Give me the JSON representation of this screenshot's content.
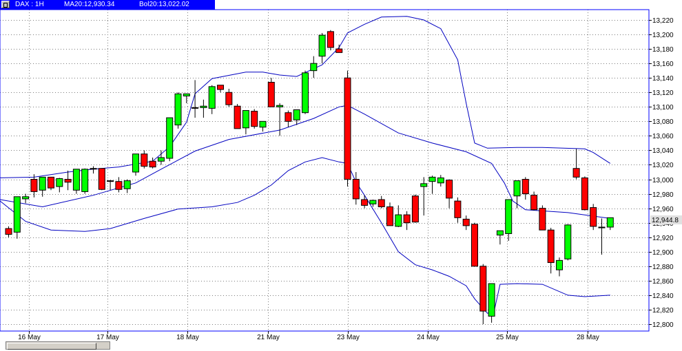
{
  "header": {
    "symbol": "DAX : 1H",
    "ma": "MA20:12,930.34",
    "bol": "Bol20:13,022.02"
  },
  "last_price_label": "12,944.8",
  "colors": {
    "up": "#00ff00",
    "down": "#ff0000",
    "band": "#0000c0",
    "grid": "#888888",
    "accent": "#0000ff"
  },
  "icons": {
    "system": "window-menu-icon"
  },
  "chart_data": {
    "type": "candlestick",
    "title": "",
    "ylim": [
      12790,
      13240
    ],
    "y_ticks": [
      12800,
      12820,
      12840,
      12860,
      12880,
      12900,
      12920,
      12940,
      12960,
      12980,
      13000,
      13020,
      13040,
      13060,
      13080,
      13100,
      13120,
      13140,
      13160,
      13180,
      13200,
      13220
    ],
    "y_tick_labels": [
      "12,800",
      "12,820",
      "12,840",
      "12,860",
      "12,880",
      "12,900",
      "12,920",
      "12,940",
      "12,960",
      "12,980",
      "13,000",
      "13,020",
      "13,040",
      "13,060",
      "13,080",
      "13,100",
      "13,120",
      "13,140",
      "13,160",
      "13,180",
      "13,200",
      "13,220"
    ],
    "x_labels": [
      {
        "label": "16 May",
        "index": 2.4
      },
      {
        "label": "17 May",
        "index": 11.7
      },
      {
        "label": "18 May",
        "index": 21.1
      },
      {
        "label": "21 May",
        "index": 30.6
      },
      {
        "label": "23 May",
        "index": 40.0
      },
      {
        "label": "24 May",
        "index": 49.5
      },
      {
        "label": "25 May",
        "index": 58.8
      },
      {
        "label": "28 May",
        "index": 68.3
      }
    ],
    "candles": [
      [
        12932,
        12935,
        12920,
        12924
      ],
      [
        12927,
        12976,
        12918,
        12976
      ],
      [
        12973,
        12980,
        12967,
        12976
      ],
      [
        13000,
        13007,
        12975,
        12983
      ],
      [
        12985,
        13003,
        12976,
        13003
      ],
      [
        13003,
        13003,
        12985,
        12988
      ],
      [
        12990,
        13002,
        12982,
        13001
      ],
      [
        13000,
        13012,
        12985,
        12996
      ],
      [
        12985,
        13014,
        12980,
        13014
      ],
      [
        12983,
        13015,
        12980,
        13014
      ],
      [
        13015,
        13018,
        13008,
        13015
      ],
      [
        13015,
        13015,
        12985,
        12986
      ],
      [
        12998,
        12999,
        12985,
        12997
      ],
      [
        12997,
        13003,
        12982,
        12986
      ],
      [
        12987,
        13000,
        12981,
        12998
      ],
      [
        13010,
        13035,
        13005,
        13035
      ],
      [
        13035,
        13040,
        13015,
        13018
      ],
      [
        13025,
        13030,
        13015,
        13017
      ],
      [
        13025,
        13040,
        13020,
        13030
      ],
      [
        13029,
        13085,
        13025,
        13085
      ],
      [
        13075,
        13120,
        13070,
        13118
      ],
      [
        13115,
        13118,
        13105,
        13118
      ],
      [
        13099,
        13137,
        13085,
        13098
      ],
      [
        13099,
        13110,
        13085,
        13101
      ],
      [
        13098,
        13130,
        13090,
        13128
      ],
      [
        13130,
        13130,
        13120,
        13124
      ],
      [
        13120,
        13125,
        13100,
        13103
      ],
      [
        13101,
        13104,
        13070,
        13070
      ],
      [
        13071,
        13090,
        13062,
        13095
      ],
      [
        13094,
        13097,
        13070,
        13073
      ],
      [
        13072,
        13076,
        13066,
        13080
      ],
      [
        13134,
        13140,
        13100,
        13100
      ],
      [
        13100,
        13105,
        13060,
        13102
      ],
      [
        13092,
        13095,
        13072,
        13080
      ],
      [
        13082,
        13095,
        13075,
        13096
      ],
      [
        13092,
        13150,
        13090,
        13147
      ],
      [
        13150,
        13170,
        13140,
        13160
      ],
      [
        13170,
        13202,
        13160,
        13199
      ],
      [
        13204,
        13206,
        13178,
        13182
      ],
      [
        13180,
        13186,
        13176,
        13175
      ],
      [
        13140,
        13150,
        12990,
        13000
      ],
      [
        13000,
        13010,
        12965,
        12973
      ],
      [
        12972,
        12978,
        12960,
        12964
      ],
      [
        12966,
        12972,
        12962,
        12971
      ],
      [
        12972,
        12977,
        12960,
        12962
      ],
      [
        12962,
        12968,
        12940,
        12936
      ],
      [
        12935,
        12964,
        12934,
        12951
      ],
      [
        12951,
        12956,
        12930,
        12940
      ],
      [
        12977,
        12979,
        12940,
        12941
      ],
      [
        12990,
        13003,
        12950,
        12994
      ],
      [
        12997,
        13005,
        12980,
        13003
      ],
      [
        12995,
        13006,
        12990,
        13002
      ],
      [
        12999,
        13000,
        12960,
        12974
      ],
      [
        12970,
        12975,
        12940,
        12947
      ],
      [
        12945,
        12950,
        12930,
        12936
      ],
      [
        12938,
        12940,
        12880,
        12880
      ],
      [
        12880,
        12883,
        12800,
        12818
      ],
      [
        12811,
        12840,
        12802,
        12856
      ],
      [
        12923,
        12926,
        12910,
        12929
      ],
      [
        12925,
        12935,
        12915,
        12972
      ],
      [
        12977,
        12996,
        12960,
        12998
      ],
      [
        13000,
        13003,
        12972,
        12980
      ],
      [
        12978,
        12983,
        12957,
        12958
      ],
      [
        12960,
        12964,
        12937,
        12930
      ],
      [
        12930,
        12933,
        12870,
        12885
      ],
      [
        12875,
        12892,
        12866,
        12888
      ],
      [
        12890,
        12938,
        12888,
        12937
      ],
      [
        13015,
        13042,
        13000,
        13003
      ],
      [
        13002,
        13004,
        12957,
        12958
      ],
      [
        12961,
        12966,
        12930,
        12935
      ],
      [
        12933,
        12946,
        12896,
        12934
      ],
      [
        12934,
        12945,
        12930,
        12947
      ]
    ],
    "series": [
      {
        "name": "MA20",
        "points": [
          [
            -1,
            12972
          ],
          [
            4,
            12962
          ],
          [
            10,
            12978
          ],
          [
            15,
            12995
          ],
          [
            18,
            13014
          ],
          [
            22,
            13039
          ],
          [
            26,
            13055
          ],
          [
            32,
            13068
          ],
          [
            36,
            13084
          ],
          [
            39,
            13100
          ],
          [
            40,
            13102
          ],
          [
            42,
            13090
          ],
          [
            46,
            13064
          ],
          [
            50,
            13050
          ],
          [
            54,
            13038
          ],
          [
            57,
            13022
          ],
          [
            58.5,
            12995
          ],
          [
            59.5,
            12970
          ],
          [
            61,
            12958
          ],
          [
            66,
            12954
          ],
          [
            71,
            12946
          ]
        ]
      },
      {
        "name": "Upper Band",
        "points": [
          [
            -1,
            13002
          ],
          [
            3,
            13003
          ],
          [
            7,
            13010
          ],
          [
            10,
            13014
          ],
          [
            13,
            13017
          ],
          [
            17,
            13025
          ],
          [
            19,
            13045
          ],
          [
            21,
            13079
          ],
          [
            22,
            13118
          ],
          [
            24,
            13139
          ],
          [
            28,
            13148
          ],
          [
            30,
            13148
          ],
          [
            32,
            13144
          ],
          [
            34,
            13142
          ],
          [
            37,
            13158
          ],
          [
            39,
            13182
          ],
          [
            40,
            13202
          ],
          [
            42,
            13214
          ],
          [
            44,
            13224
          ],
          [
            47,
            13225
          ],
          [
            49,
            13220
          ],
          [
            51,
            13208
          ],
          [
            53,
            13165
          ],
          [
            54,
            13105
          ],
          [
            55,
            13050
          ],
          [
            56.5,
            13043
          ],
          [
            60,
            13044
          ],
          [
            63,
            13044
          ],
          [
            68,
            13042
          ],
          [
            69,
            13037
          ],
          [
            71,
            13022
          ]
        ]
      },
      {
        "name": "Lower Band",
        "points": [
          [
            -1,
            12970
          ],
          [
            2,
            12942
          ],
          [
            5,
            12930
          ],
          [
            9,
            12928
          ],
          [
            12,
            12932
          ],
          [
            16,
            12946
          ],
          [
            20,
            12959
          ],
          [
            24,
            12962
          ],
          [
            27,
            12968
          ],
          [
            29,
            12978
          ],
          [
            31,
            12992
          ],
          [
            33,
            13012
          ],
          [
            35,
            13024
          ],
          [
            37,
            13030
          ],
          [
            39,
            13024
          ],
          [
            40,
            13022
          ],
          [
            41,
            12996
          ],
          [
            42,
            12978
          ],
          [
            44,
            12940
          ],
          [
            46,
            12900
          ],
          [
            48,
            12882
          ],
          [
            50,
            12875
          ],
          [
            52,
            12866
          ],
          [
            54,
            12853
          ],
          [
            55,
            12835
          ],
          [
            56.5,
            12815
          ],
          [
            57.3,
            12818
          ],
          [
            58,
            12855
          ],
          [
            60,
            12856
          ],
          [
            63,
            12855
          ],
          [
            66,
            12840
          ],
          [
            68,
            12838
          ],
          [
            71,
            12840
          ]
        ]
      }
    ]
  }
}
